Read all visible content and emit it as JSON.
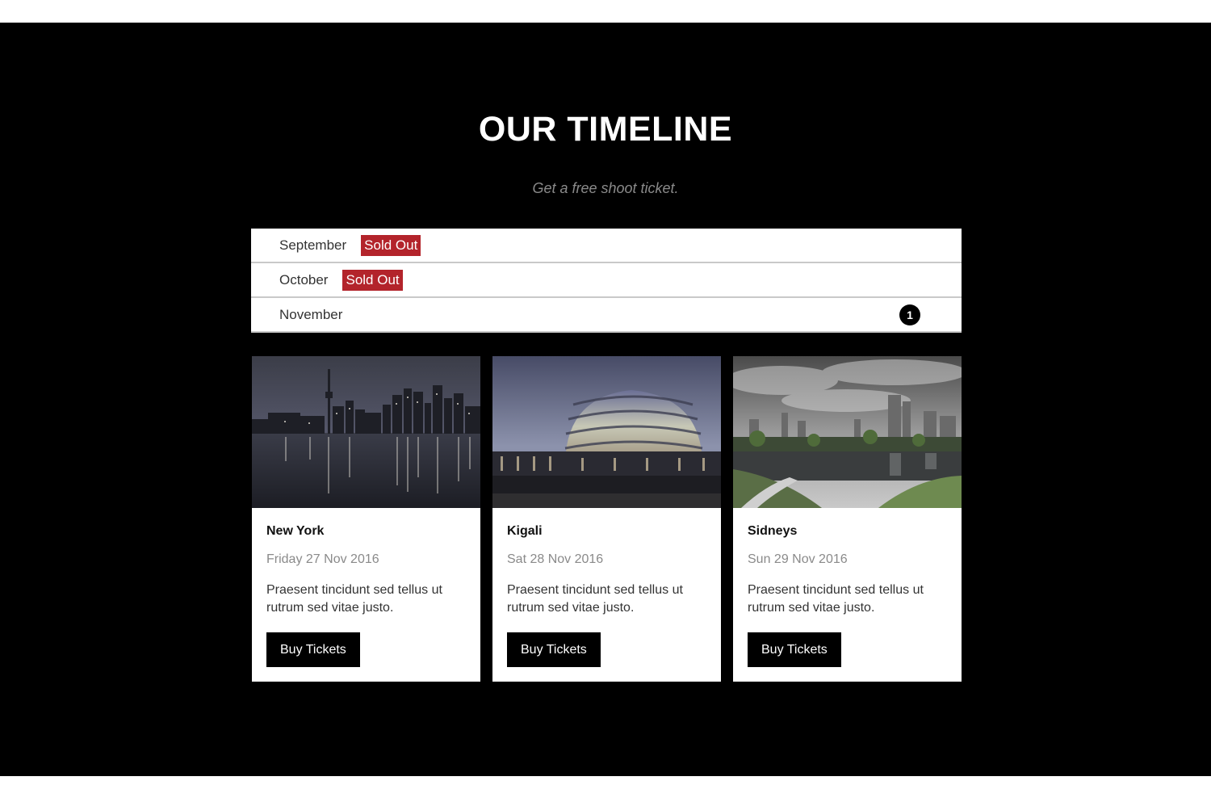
{
  "header": {
    "title": "OUR TIMELINE",
    "subtitle": "Get a free shoot ticket."
  },
  "months": [
    {
      "label": "September",
      "badge": "Sold Out"
    },
    {
      "label": "October",
      "badge": "Sold Out"
    },
    {
      "label": "November",
      "count": "1"
    }
  ],
  "events": [
    {
      "city": "New York",
      "date": "Friday 27 Nov 2016",
      "description": "Praesent tincidunt sed tellus ut rutrum sed vitae justo.",
      "button": "Buy Tickets",
      "image": "city-skyline-night-reflection"
    },
    {
      "city": "Kigali",
      "date": "Sat 28 Nov 2016",
      "description": "Praesent tincidunt sed tellus ut rutrum sed vitae justo.",
      "button": "Buy Tickets",
      "image": "dome-convention-center"
    },
    {
      "city": "Sidneys",
      "date": "Sun 29 Nov 2016",
      "description": "Praesent tincidunt sed tellus ut rutrum sed vitae justo.",
      "button": "Buy Tickets",
      "image": "park-lake-skyline"
    }
  ],
  "colors": {
    "background": "#000000",
    "badge_sold_out": "#b3242b",
    "subtitle_text": "#8a8a8a"
  }
}
